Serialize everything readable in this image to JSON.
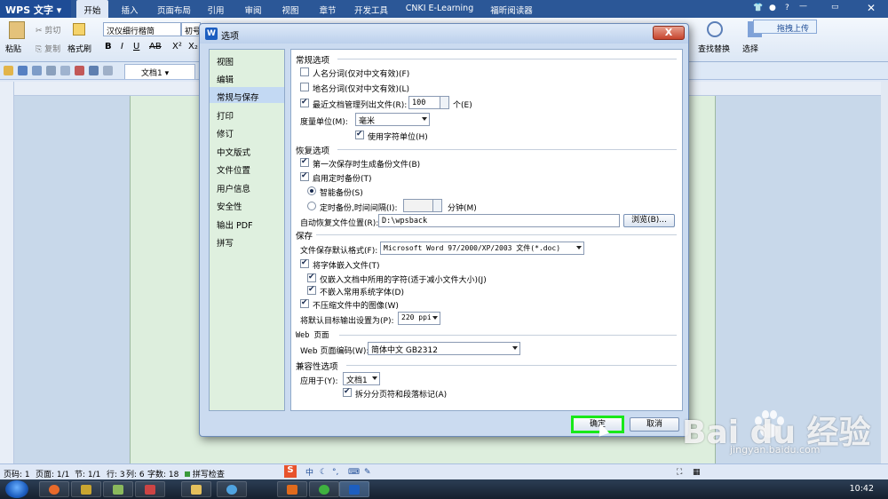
{
  "app": {
    "name": "WPS 文字",
    "menu_tabs": [
      "开始",
      "插入",
      "页面布局",
      "引用",
      "审阅",
      "视图",
      "章节",
      "开发工具",
      "CNKI E-Learning",
      "福昕阅读器"
    ],
    "upload_label": "拖拽上传"
  },
  "ribbon": {
    "paste": "粘贴",
    "cut": "剪切",
    "copy": "复制",
    "format_painter": "格式刷",
    "font": "汉仪细行楷简",
    "font_size": "初号",
    "find_replace": "查找替换",
    "select": "选择"
  },
  "quickbar": {
    "doc_tab": "文档1"
  },
  "status": {
    "page": "页码: 1",
    "pages": "页面: 1/1",
    "section": "节: 1/1",
    "row": "行: 3",
    "col": "列: 6",
    "words": "字数: 18",
    "spell": "拼写检查"
  },
  "dialog": {
    "title": "选项",
    "close": "X",
    "nav": [
      "视图",
      "编辑",
      "常规与保存",
      "打印",
      "修订",
      "中文版式",
      "文件位置",
      "用户信息",
      "安全性",
      "输出 PDF",
      "拼写"
    ],
    "nav_selected_index": 2,
    "general": {
      "heading": "常规选项",
      "person_names": "人名分词(仅对中文有效)(F)",
      "place_names": "地名分词(仅对中文有效)(L)",
      "recent_files": "最近文档管理列出文件(R):",
      "recent_count": "100",
      "recent_unit": "个(E)",
      "measure_label": "度量单位(M):",
      "measure_value": "毫米",
      "char_unit": "使用字符单位(H)"
    },
    "recovery": {
      "heading": "恢复选项",
      "backup_first_save": "第一次保存时生成备份文件(B)",
      "enable_timed_backup": "启用定时备份(T)",
      "smart_backup": "智能备份(S)",
      "timed_backup": "定时备份,时间间隔(I):",
      "minutes": "分钟(M)",
      "autosave_location_label": "自动恢复文件位置(R):",
      "autosave_location": "D:\\wpsback",
      "browse": "浏览(B)..."
    },
    "save": {
      "heading": "保存",
      "default_format_label": "文件保存默认格式(F):",
      "default_format": "Microsoft Word 97/2000/XP/2003 文件(*.doc)",
      "embed_fonts": "将字体嵌入文件(T)",
      "embed_used_chars": "仅嵌入文档中所用的字符(适于减小文件大小)(J)",
      "no_system_fonts": "不嵌入常用系统字体(D)",
      "no_compress_images": "不压缩文件中的图像(W)",
      "target_output_label": "将默认目标输出设置为(P):",
      "target_output": "220 ppi"
    },
    "web": {
      "heading": "Web 页面",
      "encoding_label": "Web 页面编码(W):",
      "encoding": "简体中文 GB2312"
    },
    "compat": {
      "heading": "兼容性选项",
      "apply_to_label": "应用于(Y):",
      "apply_to": "文档1",
      "split_page_marks": "拆分分页符和段落标记(A)"
    },
    "ok": "确定",
    "cancel": "取消"
  },
  "taskbar": {
    "time": "10:42"
  },
  "watermark": {
    "brand": "Bai  du 经验",
    "url": "jingyan.baidu.com"
  },
  "colors": {
    "ok_highlight": "#19e819",
    "title_blue": "#2b5797"
  }
}
